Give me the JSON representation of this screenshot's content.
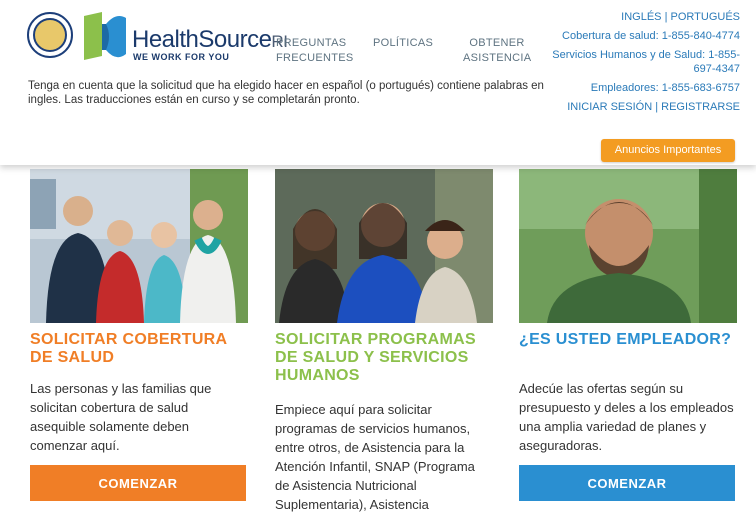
{
  "header": {
    "logo_main": "HealthSource",
    "logo_suffix": "RI",
    "logo_tagline": "WE WORK FOR YOU",
    "nav": {
      "faq": "PREGUNTAS FRECUENTES",
      "policies": "POLÍTICAS",
      "help": "OBTENER ASISTENCIA"
    },
    "notice": "Tenga en cuenta que la solicitud que ha elegido hacer en español (o portugués) contiene palabras en ingles. Las traducciones están en curso y se completarán pronto.",
    "lang_english": "INGLÉS",
    "lang_sep": " | ",
    "lang_portuguese": "PORTUGUÉS",
    "phone_health": "Cobertura de salud: 1-855-840-4774",
    "phone_human_services": "Servicios Humanos y de Salud: 1-855-697-4347",
    "phone_employers": "Empleadores: 1-855-683-6757",
    "login": "INICIAR SESIÓN",
    "auth_sep": " | ",
    "register": "REGISTRARSE",
    "announcements": "Anuncios Importantes"
  },
  "cards": [
    {
      "title": "SOLICITAR COBERTURA DE SALUD",
      "body": "Las personas y las familias que solicitan cobertura de salud asequible solamente deben comenzar aquí.",
      "button": "COMENZAR"
    },
    {
      "title": "SOLICITAR PROGRAMAS DE SALUD Y SERVICIOS HUMANOS",
      "body": "Empiece aquí para solicitar programas de servicios humanos, entre otros, de Asistencia para la Atención Infantil, SNAP (Programa de Asistencia Nutricional Suplementaria), Asistencia"
    },
    {
      "title": "¿ES USTED EMPLEADOR?",
      "body": "Adecúe las ofertas según su presupuesto y deles a los empleados una amplia variedad de planes y aseguradoras.",
      "button": "COMENZAR"
    }
  ],
  "colors": {
    "orange": "#f07e26",
    "green": "#8cc04b",
    "blue": "#2a8fd1",
    "announce": "#f39c22",
    "link": "#2a7ab8"
  }
}
